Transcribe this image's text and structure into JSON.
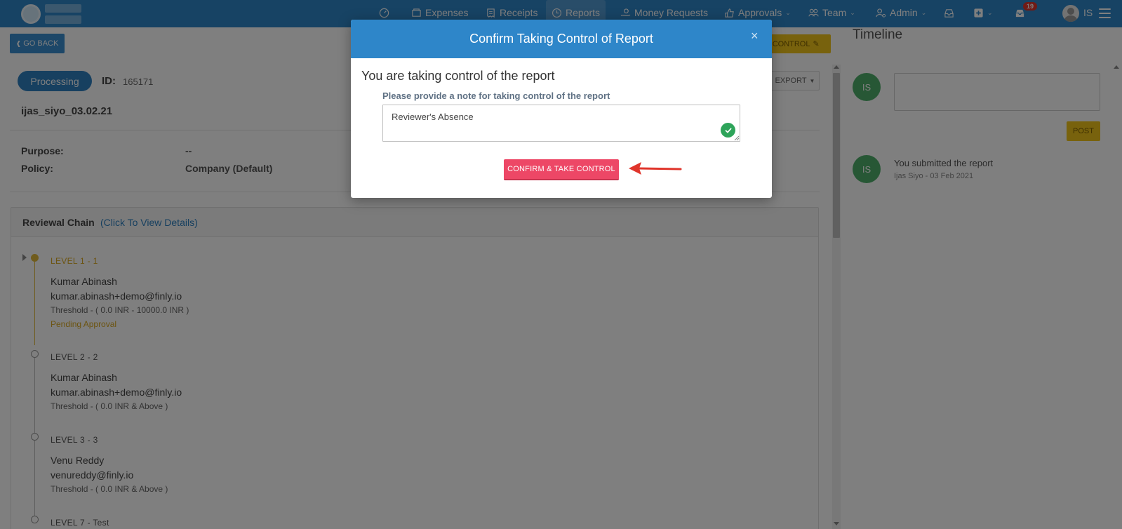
{
  "navbar": {
    "items": [
      {
        "label": "Expenses",
        "icon": "expenses-icon"
      },
      {
        "label": "Receipts",
        "icon": "receipts-icon"
      },
      {
        "label": "Reports",
        "icon": "reports-icon"
      },
      {
        "label": "Money Requests",
        "icon": "money-requests-icon"
      },
      {
        "label": "Approvals",
        "icon": "approvals-icon"
      },
      {
        "label": "Team",
        "icon": "team-icon"
      },
      {
        "label": "Admin",
        "icon": "admin-icon"
      }
    ],
    "notification_count": "19",
    "user_initials": "IS"
  },
  "page": {
    "go_back_label": "GO BACK",
    "take_control_label": "E CONTROL",
    "export_label": "EXPORT",
    "status": "Processing",
    "id_label": "ID:",
    "id_value": "165171",
    "report_name": "ijas_siyo_03.02.21",
    "purpose_label": "Purpose:",
    "purpose_value": "--",
    "policy_label": "Policy:",
    "policy_value": "Company (Default)",
    "chain_title": "Reviewal Chain",
    "chain_link": "(Click To View Details)",
    "levels": [
      {
        "title": "LEVEL 1 -  1",
        "name": "Kumar Abinash",
        "email": "kumar.abinash+demo@finly.io",
        "threshold": "Threshold -  ( 0.0 INR - 10000.0 INR )",
        "status": "Pending Approval"
      },
      {
        "title": "LEVEL 2 -  2",
        "name": "Kumar Abinash",
        "email": "kumar.abinash+demo@finly.io",
        "threshold": "Threshold -  ( 0.0 INR & Above )",
        "status": ""
      },
      {
        "title": "LEVEL 3 -  3",
        "name": "Venu Reddy",
        "email": "venureddy@finly.io",
        "threshold": "Threshold -  ( 0.0 INR & Above )",
        "status": ""
      },
      {
        "title": "LEVEL 7 -  Test",
        "name": "",
        "email": "",
        "threshold": "",
        "status": ""
      }
    ]
  },
  "timeline": {
    "title": "Timeline",
    "avatar_initials": "IS",
    "post_label": "POST",
    "event_text": "You submitted the report",
    "event_meta": "Ijas Siyo - 03 Feb 2021"
  },
  "modal": {
    "title": "Confirm Taking Control of Report",
    "close_symbol": "×",
    "heading": "You are taking control of the report",
    "note_label": "Please provide a note for taking control of the report",
    "note_value": "Reviewer's Absence",
    "confirm_label": "CONFIRM & TAKE CONTROL"
  },
  "colors": {
    "brand_blue": "#2e86c9",
    "confirm_red": "#ed4766",
    "warning_yellow": "#f0c41b",
    "success_green": "#2ea45a",
    "arrow_red": "#e0352b"
  }
}
